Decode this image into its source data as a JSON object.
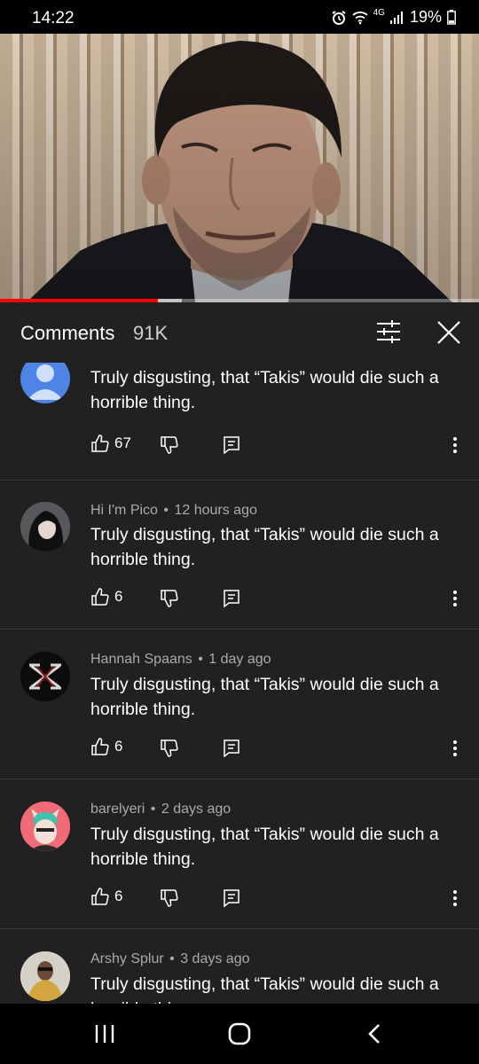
{
  "status_bar": {
    "time": "14:22",
    "network": "4G",
    "battery": "19%"
  },
  "video": {
    "progress_fraction": 0.33,
    "buffer_fraction": 0.38
  },
  "comments_panel": {
    "title": "Comments",
    "count": "91K"
  },
  "comments": [
    {
      "author": "",
      "time": "",
      "text": "Truly disgusting, that “Takis” would die such a horrible thing.",
      "likes": "67",
      "avatar": "default-person-icon"
    },
    {
      "author": "Hi I'm Pico",
      "time": "12 hours ago",
      "text": "Truly disgusting, that “Takis” would die such a horrible thing.",
      "likes": "6",
      "avatar": "anime-girl-avatar"
    },
    {
      "author": "Hannah Spaans",
      "time": "1 day ago",
      "text": "Truly disgusting, that “Takis” would die such a horrible thing.",
      "likes": "6",
      "avatar": "hunter-logo-avatar"
    },
    {
      "author": "barelyeri",
      "time": "2 days ago",
      "text": "Truly disgusting, that “Takis” would die such a horrible thing.",
      "likes": "6",
      "avatar": "horned-character-avatar"
    },
    {
      "author": "Arshy Splur",
      "time": "3 days ago",
      "text": "Truly disgusting, that “Takis” would die such a horrible thing.",
      "likes": "",
      "avatar": "photo-avatar"
    }
  ],
  "colors": {
    "background": "#212121",
    "progress": "#ff0000",
    "meta_text": "#aaaaaa"
  }
}
